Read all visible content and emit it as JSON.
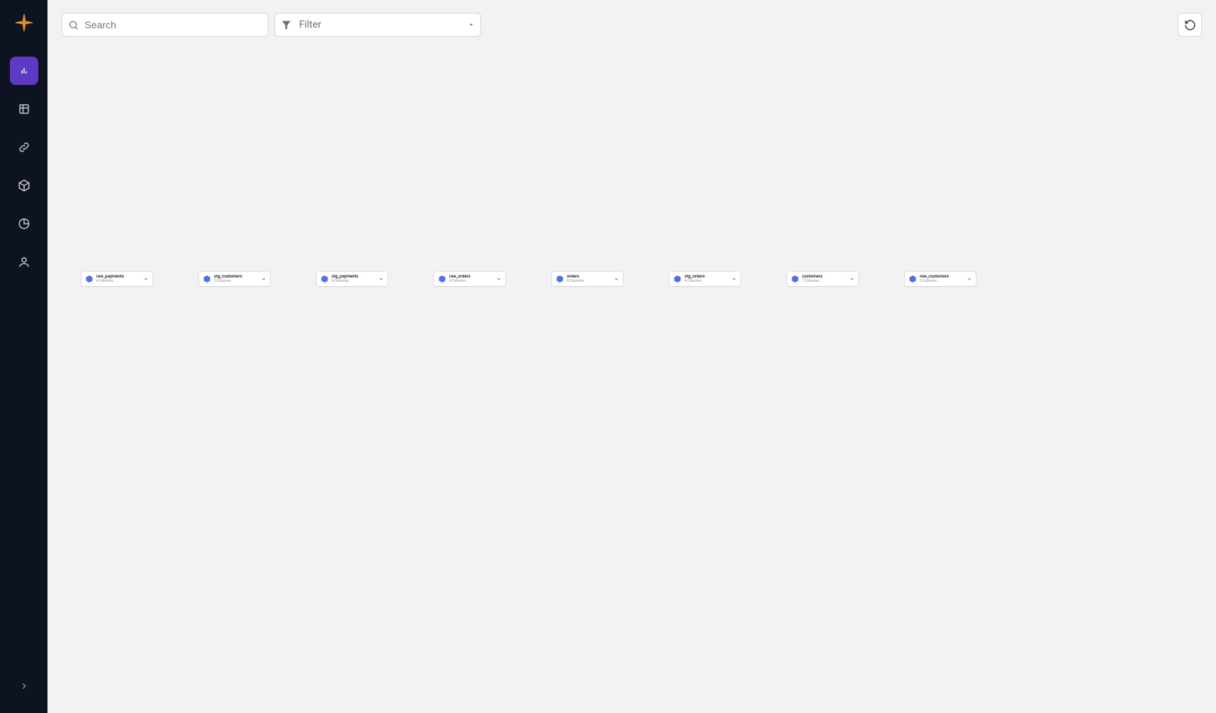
{
  "topbar": {
    "search_placeholder": "Search",
    "filter_label": "Filter"
  },
  "entities": [
    {
      "name": "raw_payments",
      "columns_label": "4 Columns"
    },
    {
      "name": "stg_customers",
      "columns_label": "3 Columns"
    },
    {
      "name": "stg_payments",
      "columns_label": "4 Columns"
    },
    {
      "name": "raw_orders",
      "columns_label": "4 Columns"
    },
    {
      "name": "orders",
      "columns_label": "9 Columns"
    },
    {
      "name": "stg_orders",
      "columns_label": "4 Columns"
    },
    {
      "name": "customers",
      "columns_label": "7 Columns"
    },
    {
      "name": "raw_customers",
      "columns_label": "3 Columns"
    }
  ]
}
